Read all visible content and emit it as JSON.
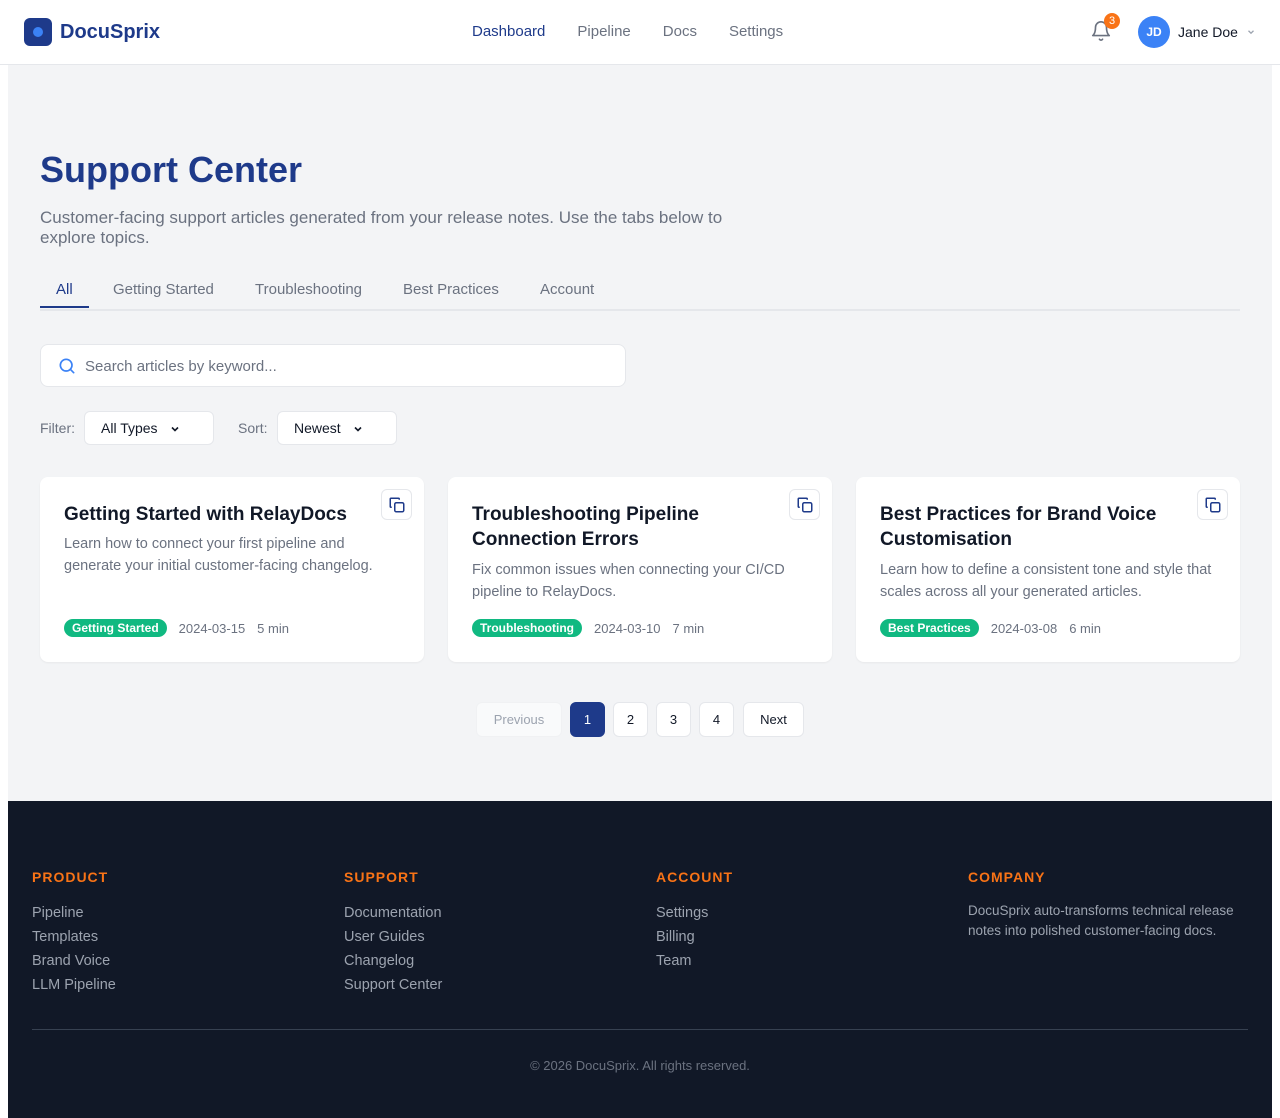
{
  "header": {
    "brand": "DocuSprix",
    "nav": [
      "Dashboard",
      "Pipeline",
      "Docs",
      "Settings"
    ],
    "active_nav": "Dashboard",
    "notification_count": "3",
    "user": {
      "initials": "JD",
      "name": "Jane Doe"
    }
  },
  "page": {
    "title": "Support Center",
    "subtitle": "Customer-facing support articles generated from your release notes. Use the tabs below to explore topics.",
    "tabs": [
      "All",
      "Getting Started",
      "Troubleshooting",
      "Best Practices",
      "Account"
    ],
    "active_tab": "All",
    "search": {
      "placeholder": "Search articles by keyword...",
      "value": ""
    },
    "filter": {
      "label": "Filter:",
      "value": "All Types"
    },
    "sort": {
      "label": "Sort:",
      "value": "Newest"
    }
  },
  "articles": [
    {
      "title": "Getting Started with RelayDocs",
      "description": "Learn how to connect your first pipeline and generate your initial customer-facing changelog.",
      "category": "Getting Started",
      "date": "2024-03-15",
      "read_time": "5 min"
    },
    {
      "title": "Troubleshooting Pipeline Connection Errors",
      "description": "Fix common issues when connecting your CI/CD pipeline to RelayDocs.",
      "category": "Troubleshooting",
      "date": "2024-03-10",
      "read_time": "7 min"
    },
    {
      "title": "Best Practices for Brand Voice Customisation",
      "description": "Learn how to define a consistent tone and style that scales across all your generated articles.",
      "category": "Best Practices",
      "date": "2024-03-08",
      "read_time": "6 min"
    }
  ],
  "pagination": {
    "previous": "Previous",
    "pages": [
      "1",
      "2",
      "3",
      "4"
    ],
    "current": "1",
    "next": "Next"
  },
  "footer": {
    "columns": [
      {
        "heading": "PRODUCT",
        "links": [
          "Pipeline",
          "Templates",
          "Brand Voice",
          "LLM Pipeline"
        ]
      },
      {
        "heading": "SUPPORT",
        "links": [
          "Documentation",
          "User Guides",
          "Changelog",
          "Support Center"
        ]
      },
      {
        "heading": "ACCOUNT",
        "links": [
          "Settings",
          "Billing",
          "Team"
        ]
      }
    ],
    "company": {
      "heading": "COMPANY",
      "text": "DocuSprix auto-transforms technical release notes into polished customer-facing docs."
    },
    "copyright": "© 2026 DocuSprix. All rights reserved."
  },
  "colors": {
    "primary": "#1e3a8a",
    "accent": "#3b82f6",
    "badge": "#10b981",
    "footer_heading": "#f97316",
    "footer_bg": "#111827"
  }
}
